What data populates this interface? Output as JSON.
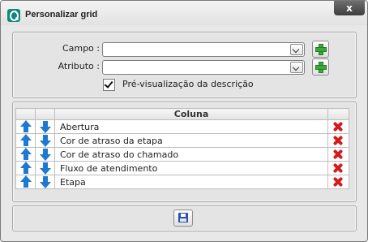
{
  "window": {
    "title": "Personalizar grid",
    "close_label": "x"
  },
  "form": {
    "campo_label": "Campo :",
    "campo_value": "",
    "atributo_label": "Atributo :",
    "atributo_value": "",
    "preview_label": "Pré-visualização da descrição",
    "preview_checked": true
  },
  "grid": {
    "header": "Coluna",
    "rows": [
      {
        "label": "Abertura"
      },
      {
        "label": "Cor de atraso da etapa"
      },
      {
        "label": "Cor de atraso do chamado"
      },
      {
        "label": "Fluxo de atendimento"
      },
      {
        "label": "Etapa"
      }
    ]
  },
  "icons": {
    "app": "app-logo-icon",
    "move_up": "arrow-up-icon",
    "move_down": "arrow-down-icon",
    "delete": "delete-x-icon",
    "add": "plus-icon",
    "save": "floppy-disk-icon"
  },
  "colors": {
    "arrow": "#1e7ad0",
    "delete": "#d51c1c",
    "add": "#3aa83a",
    "app_icon": "#0f8a7a"
  }
}
